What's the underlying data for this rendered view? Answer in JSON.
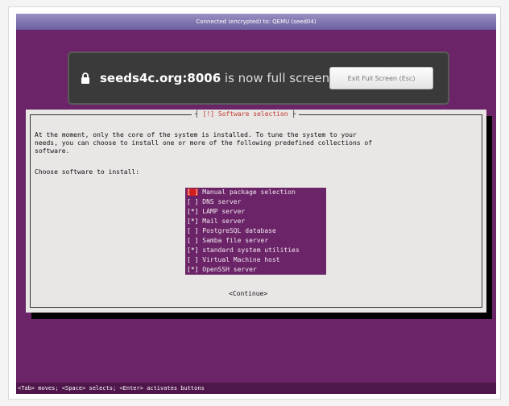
{
  "vnc": {
    "title": "Connected (encrypted) to: QEMU (seed04)"
  },
  "fullscreen_notice": {
    "host": "seeds4c.org:8006",
    "message": " is now full screen",
    "exit_button": "Exit Full Screen (Esc)"
  },
  "installer": {
    "title": "[!] Software selection",
    "description": "At the moment, only the core of the system is installed. To tune the system to your\nneeds, you can choose to install one or more of the following predefined collections of\nsoftware.",
    "prompt": "Choose software to install:",
    "items": [
      {
        "box": "[ ]",
        "label": " Manual package selection",
        "checked": false
      },
      {
        "box": "[ ]",
        "label": " DNS server",
        "checked": false
      },
      {
        "box": "[*]",
        "label": " LAMP server",
        "checked": true
      },
      {
        "box": "[*]",
        "label": " Mail server",
        "checked": true
      },
      {
        "box": "[ ]",
        "label": " PostgreSQL database",
        "checked": false
      },
      {
        "box": "[ ]",
        "label": " Samba file server",
        "checked": false
      },
      {
        "box": "[*]",
        "label": " standard system utilities",
        "checked": true
      },
      {
        "box": "[ ]",
        "label": " Virtual Machine host",
        "checked": false
      },
      {
        "box": "[*]",
        "label": " OpenSSH server",
        "checked": true
      }
    ],
    "continue_button": "<Continue>"
  },
  "status_bar": "<Tab> moves; <Space> selects; <Enter> activates buttons",
  "colors": {
    "background_purple": "#6b2467",
    "dialog_gray": "#e9e6e6",
    "focus_red": "#d11f1f",
    "title_red": "#c0392b"
  },
  "icons": {
    "lock": "lock-icon"
  }
}
